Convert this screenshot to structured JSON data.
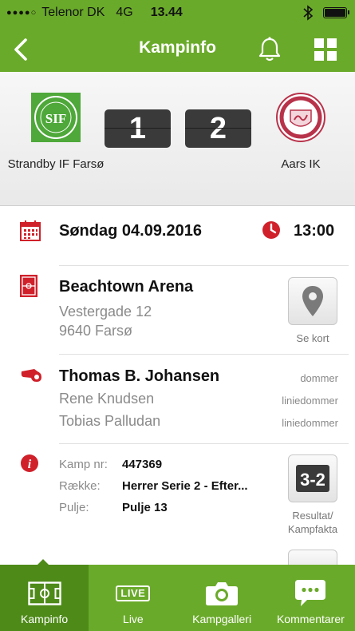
{
  "status_bar": {
    "signal": "●●●●○",
    "carrier": "Telenor DK",
    "network": "4G",
    "time": "13.44",
    "battery_level": 0.92
  },
  "nav": {
    "title": "Kampinfo",
    "back_icon": "chevron-left-icon",
    "bell_icon": "bell-icon",
    "grid_icon": "grid-icon"
  },
  "match": {
    "home_team": "Strandby IF Farsø",
    "away_team": "Aars IK",
    "home_score": "1",
    "away_score": "2",
    "home_logo_text": "SIF",
    "away_logo_text": "IDRÆTS KLUB AARS"
  },
  "date_row": {
    "date": "Søndag 04.09.2016",
    "time": "13:00"
  },
  "venue": {
    "name": "Beachtown Arena",
    "address": "Vestergade 12",
    "city": "9640 Farsø",
    "map_button_label": "Se kort"
  },
  "referees": {
    "main": "Thomas B. Johansen",
    "main_role": "dommer",
    "assistant1": "Rene Knudsen",
    "assistant1_role": "liniedommer",
    "assistant2": "Tobias Palludan",
    "assistant2_role": "liniedommer"
  },
  "info": {
    "match_no_label": "Kamp nr:",
    "match_no": "447369",
    "series_label": "Række:",
    "series": "Herrer Serie 2 - Efter...",
    "pool_label": "Pulje:",
    "pool": "Pulje 13",
    "result_button_label": "Resultat/\nKampfakta"
  },
  "tabs": [
    {
      "label": "Kampinfo",
      "icon": "pitch-icon",
      "active": true
    },
    {
      "label": "Live",
      "icon": "live-icon",
      "badge": "LIVE",
      "active": false
    },
    {
      "label": "Kampgalleri",
      "icon": "camera-icon",
      "active": false
    },
    {
      "label": "Kommentarer",
      "icon": "chat-icon",
      "active": false
    }
  ],
  "colors": {
    "brand_green": "#6aaa2a",
    "active_tab": "#4e8a18",
    "accent_red": "#d0202a",
    "score_bg": "#3a3a3a"
  }
}
